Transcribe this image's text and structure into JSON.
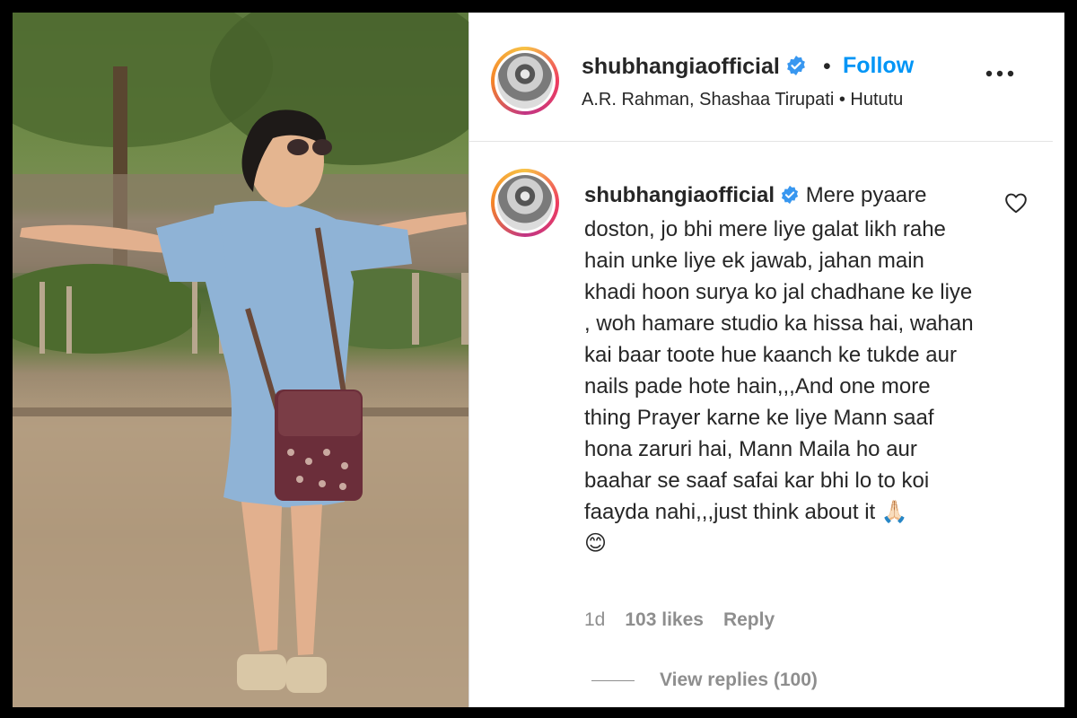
{
  "post": {
    "username": "shubhangiaofficial",
    "follow_label": "Follow",
    "separator": "•",
    "audio": "A.R. Rahman, Shashaa Tirupati • Hututu"
  },
  "comment": {
    "username": "shubhangiaofficial",
    "text": "Mere pyaare doston, jo bhi mere liye galat likh rahe hain unke liye ek jawab, jahan main khadi hoon surya ko jal chadhane ke liye , woh hamare studio ka hissa hai, wahan kai baar toote hue kaanch ke tukde aur nails pade hote hain,,,And one more thing Prayer karne ke liye Mann saaf hona zaruri hai, Mann Maila ho aur baahar se saaf safai kar bhi lo to koi faayda nahi,,,just think about it",
    "emoji_1": "🙏🏻",
    "emoji_2": "😊",
    "age": "1d",
    "likes": "103 likes",
    "reply_label": "Reply",
    "view_replies": "View replies (100)"
  },
  "icons": {
    "verified": "verified-badge-icon",
    "more": "more-options-icon",
    "heart": "heart-outline-icon"
  },
  "colors": {
    "accent": "#0095f6",
    "verified": "#3897f0",
    "muted": "#8e8e8e",
    "text": "#262626"
  }
}
